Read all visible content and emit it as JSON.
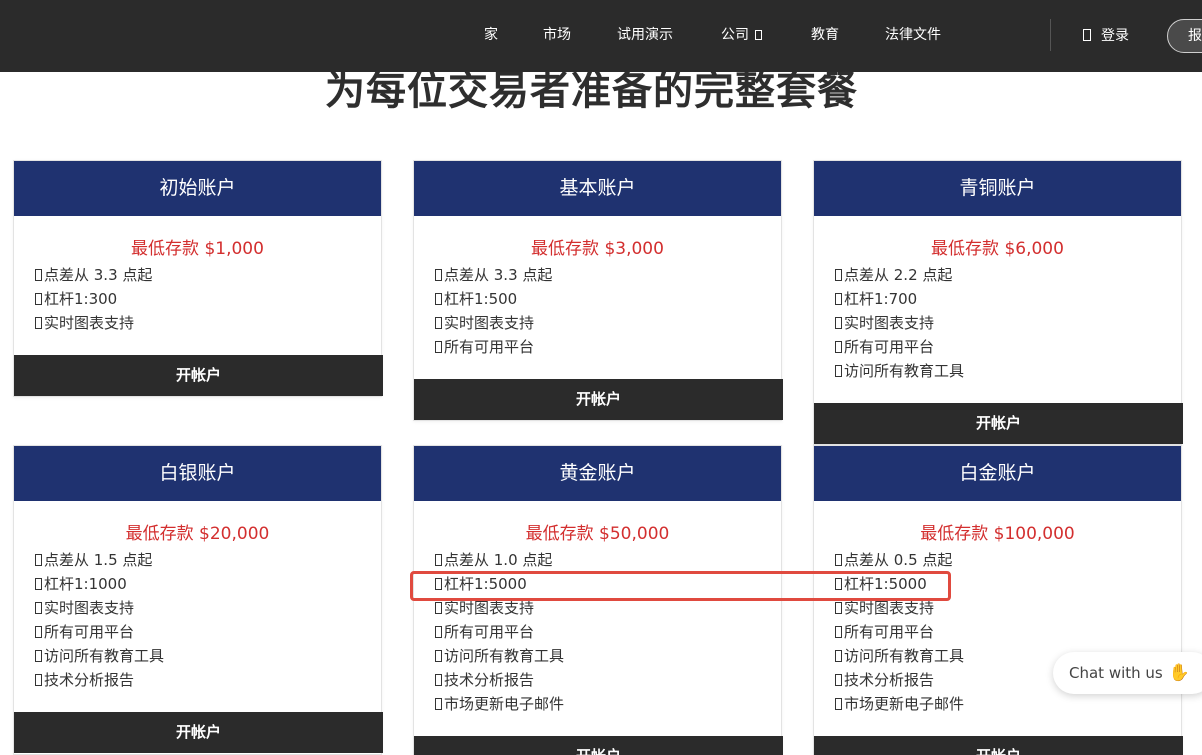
{
  "header": {
    "nav": [
      "家",
      "市场",
      "试用演示",
      "公司",
      "教育",
      "法律文件"
    ],
    "login_label": "登录",
    "cta_label": "报"
  },
  "page": {
    "title": "为每位交易者准备的完整套餐"
  },
  "open_label": "开帐户",
  "cards": [
    {
      "name": "初始账户",
      "deposit": "最低存款 $1,000",
      "features": [
        "点差从 3.3 点起",
        "杠杆1:300",
        "实时图表支持"
      ]
    },
    {
      "name": "基本账户",
      "deposit": "最低存款 $3,000",
      "features": [
        "点差从 3.3 点起",
        "杠杆1:500",
        "实时图表支持",
        "所有可用平台"
      ]
    },
    {
      "name": "青铜账户",
      "deposit": "最低存款 $6,000",
      "features": [
        "点差从 2.2 点起",
        "杠杆1:700",
        "实时图表支持",
        "所有可用平台",
        "访问所有教育工具"
      ]
    },
    {
      "name": "白银账户",
      "deposit": "最低存款 $20,000",
      "features": [
        "点差从 1.5 点起",
        "杠杆1:1000",
        "实时图表支持",
        "所有可用平台",
        "访问所有教育工具",
        "技术分析报告"
      ]
    },
    {
      "name": "黄金账户",
      "deposit": "最低存款 $50,000",
      "features": [
        "点差从 1.0 点起",
        "杠杆1:5000",
        "实时图表支持",
        "所有可用平台",
        "访问所有教育工具",
        "技术分析报告",
        "市场更新电子邮件"
      ]
    },
    {
      "name": "白金账户",
      "deposit": "最低存款 $100,000",
      "features": [
        "点差从 0.5 点起",
        "杠杆1:5000",
        "实时图表支持",
        "所有可用平台",
        "访问所有教育工具",
        "技术分析报告",
        "市场更新电子邮件"
      ]
    }
  ],
  "chat": {
    "label": "Chat with us"
  },
  "colors": {
    "header_bg": "#2b2b2b",
    "card_header_bg": "#1f3270",
    "deposit_text": "#d32f2f",
    "highlight_border": "#e04a3f",
    "title_highlight": "#ecdcb6"
  }
}
